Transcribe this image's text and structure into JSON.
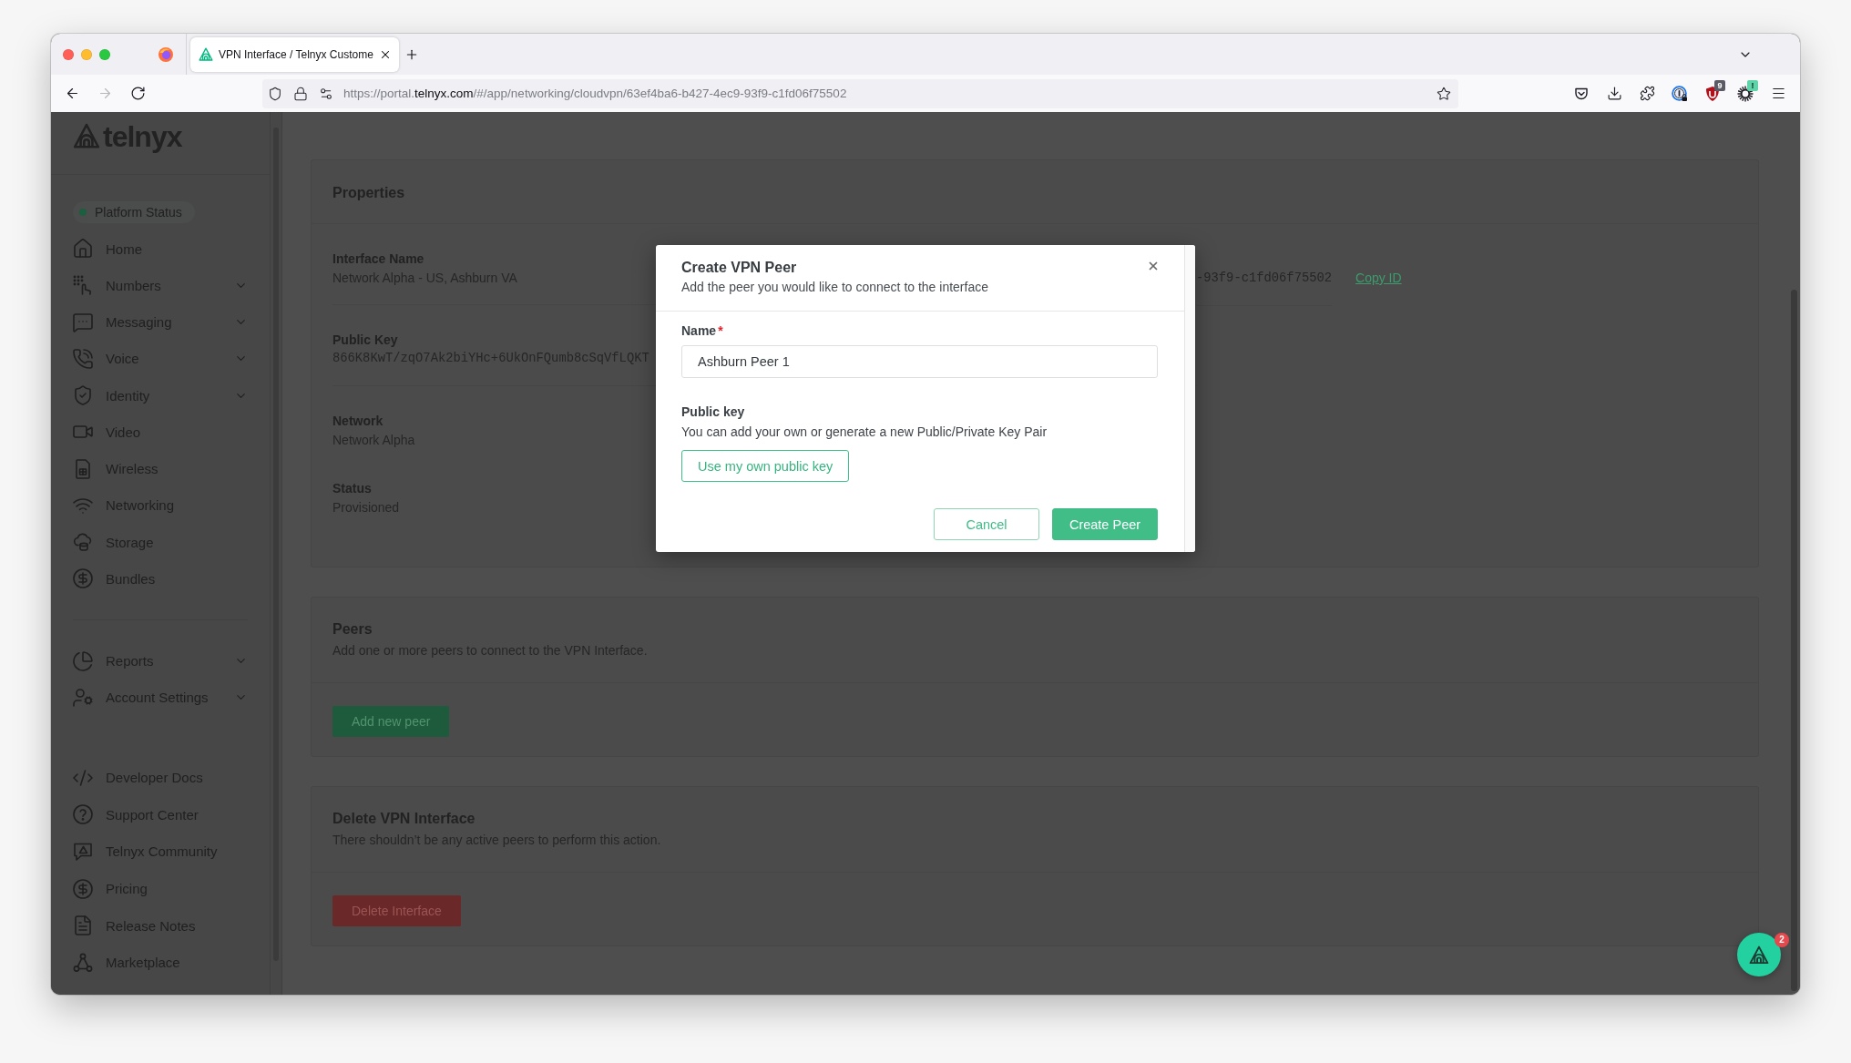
{
  "browser": {
    "tab": {
      "title": "VPN Interface / Telnyx Custome",
      "selected": true
    },
    "nav_buttons": [
      {
        "kind": "back",
        "disabled": false
      },
      {
        "kind": "forward",
        "disabled": true
      },
      {
        "kind": "reload",
        "disabled": false
      }
    ],
    "url": [
      {
        "text": "https://portal.",
        "highlighted": false
      },
      {
        "text": "telnyx.com",
        "highlighted": true
      },
      {
        "text": "/#/app/networking/cloudvpn/63ef4ba6-b427-4ec9-93f9-c1fd06f75502",
        "highlighted": false
      }
    ],
    "toolbar_icons": [
      {
        "kind": "pocket"
      },
      {
        "kind": "downloads"
      },
      {
        "kind": "extensions"
      },
      {
        "kind": "password"
      },
      {
        "kind": "blocker",
        "badge": {
          "text": "9",
          "color": "#5b5b66"
        }
      },
      {
        "kind": "gear",
        "badge": {
          "text": "!",
          "color": "#5fd4a8"
        }
      },
      {
        "kind": "menu"
      }
    ]
  },
  "sidebar": {
    "logo": "telnyx",
    "status": "Platform Status",
    "main_items": [
      {
        "label": "Home",
        "kind": "home",
        "submenu": false
      },
      {
        "label": "Numbers",
        "kind": "numbers",
        "submenu": true
      },
      {
        "label": "Messaging",
        "kind": "messaging",
        "submenu": true
      },
      {
        "label": "Voice",
        "kind": "voice",
        "submenu": true
      },
      {
        "label": "Identity",
        "kind": "identity",
        "submenu": true
      },
      {
        "label": "Video",
        "kind": "video",
        "submenu": false
      },
      {
        "label": "Wireless",
        "kind": "wireless",
        "submenu": false
      },
      {
        "label": "Networking",
        "kind": "networking",
        "submenu": false
      },
      {
        "label": "Storage",
        "kind": "storage",
        "submenu": false
      },
      {
        "label": "Bundles",
        "kind": "bundles",
        "submenu": false
      }
    ],
    "account_items": [
      {
        "label": "Reports",
        "kind": "reports",
        "submenu": true
      },
      {
        "label": "Account Settings",
        "kind": "account",
        "submenu": true
      }
    ],
    "help_items": [
      {
        "label": "Developer Docs",
        "kind": "docs",
        "submenu": false
      },
      {
        "label": "Support Center",
        "kind": "support",
        "submenu": false
      },
      {
        "label": "Telnyx Community",
        "kind": "community",
        "submenu": false
      },
      {
        "label": "Pricing",
        "kind": "pricing",
        "submenu": false
      },
      {
        "label": "Release Notes",
        "kind": "release_notes",
        "submenu": false
      },
      {
        "label": "Marketplace",
        "kind": "marketplace",
        "submenu": false
      }
    ]
  },
  "properties": {
    "title": "Properties",
    "fields": [
      {
        "label": "Interface Name",
        "value": "Network Alpha - US, Ashburn VA",
        "kind": "text"
      },
      {
        "label": "Public Key",
        "value": "866K8KwT/zqO7Ak2biYHc+6UkOnFQumb8cSqVfLQKT",
        "kind": "mono"
      },
      {
        "label": "Network",
        "value": "Network Alpha",
        "kind": "text"
      },
      {
        "label": "Status",
        "value": "Provisioned",
        "kind": "text"
      }
    ],
    "interface_id": {
      "value": "-93f9-c1fd06f75502",
      "link": "Copy ID"
    }
  },
  "sections": [
    {
      "title": "Peers",
      "description": "Add one or more peers to connect to the VPN Interface.",
      "button": {
        "label": "Add new peer",
        "kind": "primary"
      }
    },
    {
      "title": "Delete VPN Interface",
      "description": "There shouldn’t be any active peers to perform this action.",
      "button": {
        "label": "Delete Interface",
        "kind": "danger"
      }
    }
  ],
  "modal": {
    "title": "Create VPN Peer",
    "subtitle": "Add the peer you would like to connect to the interface",
    "name_field": {
      "label": "Name",
      "required_mark": "*",
      "value": "Ashburn Peer 1"
    },
    "public_key": {
      "label": "Public key",
      "description": "You can add your own or generate a new Public/Private Key Pair",
      "button": "Use my own public key"
    },
    "actions": [
      {
        "label": "Cancel",
        "kind": "secondary"
      },
      {
        "label": "Create Peer",
        "kind": "primary"
      }
    ]
  },
  "chat": {
    "badge": "2"
  }
}
